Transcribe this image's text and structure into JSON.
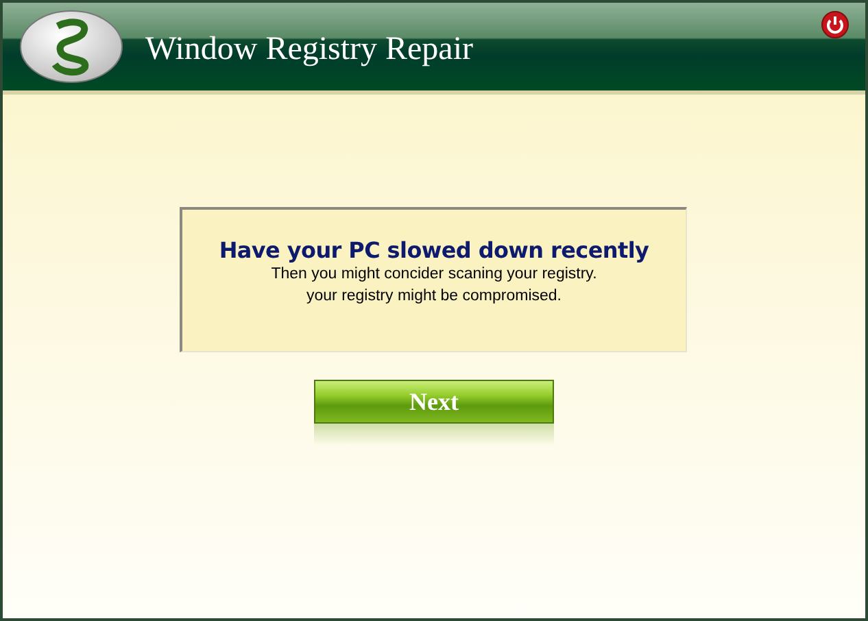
{
  "window": {
    "title": "Window Registry Repair"
  },
  "message": {
    "heading": "Have your PC slowed down recently",
    "lines": [
      "Then you might concider scaning your registry.",
      "your registry might be compromised."
    ]
  },
  "buttons": [
    "Next"
  ]
}
